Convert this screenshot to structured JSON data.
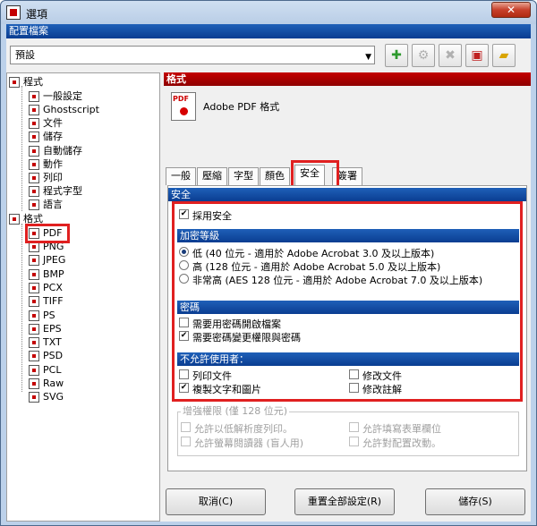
{
  "window": {
    "title": "選項",
    "close_label": "✕"
  },
  "profile": {
    "header": "配置檔案",
    "selected": "預設"
  },
  "toolbar": {
    "icons": [
      "add-icon",
      "settings-icon",
      "delete-icon",
      "save-icon",
      "folder-icon"
    ]
  },
  "tree": {
    "program_root": "程式",
    "program_items": [
      "一般設定",
      "Ghostscript",
      "文件",
      "儲存",
      "自動儲存",
      "動作",
      "列印",
      "程式字型",
      "語言"
    ],
    "format_root": "格式",
    "format_items": [
      "PDF",
      "PNG",
      "JPEG",
      "BMP",
      "PCX",
      "TIFF",
      "PS",
      "EPS",
      "TXT",
      "PSD",
      "PCL",
      "Raw",
      "SVG"
    ]
  },
  "format_panel": {
    "header": "格式",
    "format_name": "Adobe PDF 格式"
  },
  "tabs": [
    "一般",
    "壓縮",
    "字型",
    "顏色",
    "安全",
    "簽署"
  ],
  "security": {
    "header": "安全",
    "use_security": "採用安全",
    "encryption_header": "加密等級",
    "levels": [
      "低 (40 位元 - 適用於 Adobe Acrobat 3.0 及以上版本)",
      "高 (128 位元 - 適用於 Adobe Acrobat 5.0 及以上版本)",
      "非常高 (AES 128 位元 - 適用於 Adobe Acrobat 7.0 及以上版本)"
    ],
    "password_header": "密碼",
    "password_options": [
      "需要用密碼開啟檔案",
      "需要密碼變更權限與密碼"
    ],
    "disallow_header": "不允許使用者：",
    "disallow_options": [
      "列印文件",
      "修改文件",
      "複製文字和圖片",
      "修改註解"
    ],
    "enhanced_header": "增強權限 (僅 128 位元)",
    "enhanced_options": [
      "允許以低解析度列印。",
      "允許填寫表單欄位",
      "允許螢幕閱讀器 (盲人用)",
      "允許對配置改動。"
    ]
  },
  "buttons": {
    "cancel": "取消(C)",
    "reset": "重置全部設定(R)",
    "save": "儲存(S)"
  }
}
